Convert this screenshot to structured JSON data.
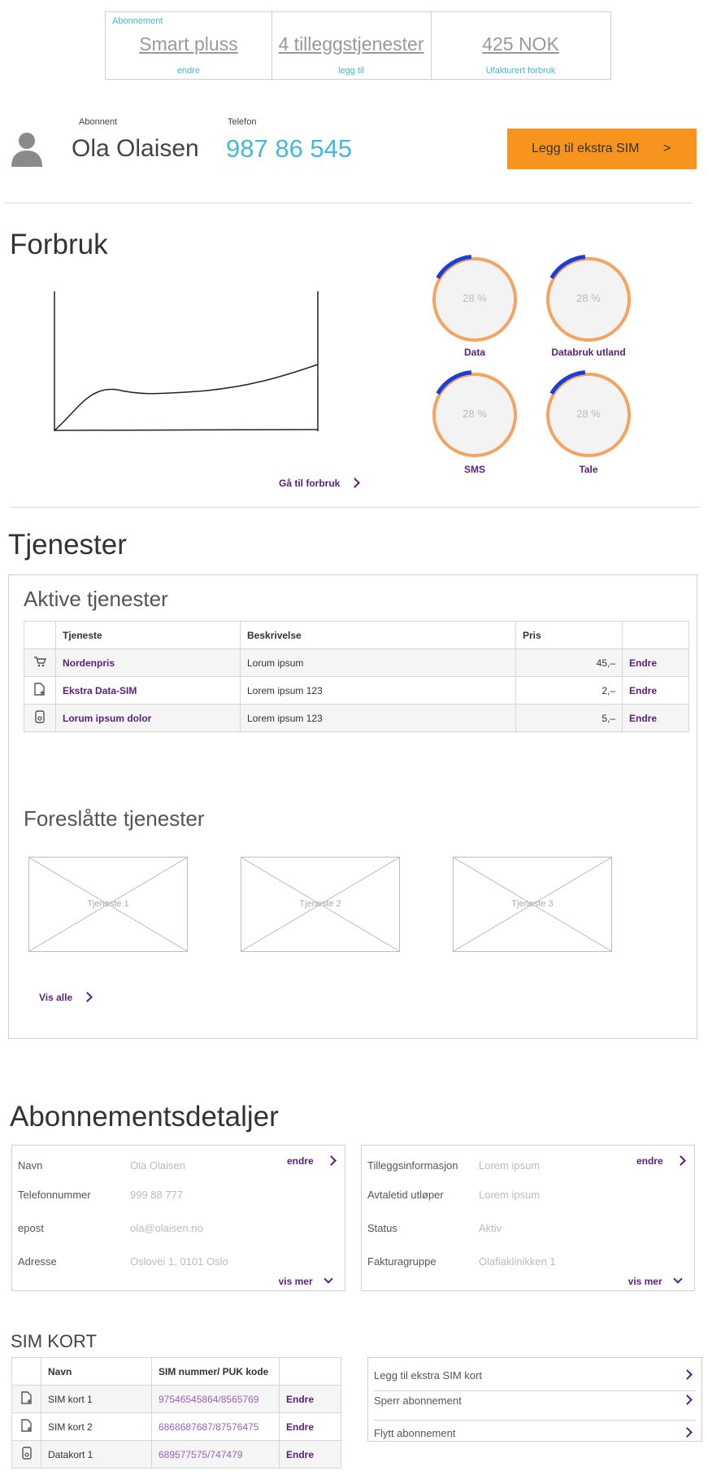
{
  "summary": {
    "tag": "Abonnement",
    "cells": [
      {
        "big": "Smart pluss",
        "small": "endre"
      },
      {
        "big": "4 tilleggstjenester",
        "small": "legg til"
      },
      {
        "big": "425 NOK",
        "small": "Ufakturert forbruk"
      }
    ]
  },
  "subscriber": {
    "name_label": "Abonnent",
    "name": "Ola Olaisen",
    "phone_label": "Telefon",
    "phone": "987 86 545",
    "cta": "Legg til ekstra SIM",
    "cta_arrow": ">"
  },
  "usage": {
    "title": "Forbruk",
    "link": "Gå til forbruk",
    "donuts": [
      {
        "label": "Data",
        "percent_text": "28 %",
        "value": 0.28
      },
      {
        "label": "Databruk utland",
        "percent_text": "28 %",
        "value": 0.28
      },
      {
        "label": "SMS",
        "percent_text": "28 %",
        "value": 0.28
      },
      {
        "label": "Tale",
        "percent_text": "28 %",
        "value": 0.28
      }
    ],
    "colors": {
      "ring": "#f4a460",
      "progress": "#1a3fd6",
      "fill": "#f3f3f3"
    }
  },
  "services": {
    "title": "Tjenester",
    "active_title": "Aktive tjenester",
    "columns": [
      "Tjeneste",
      "Beskrivelse",
      "Pris"
    ],
    "rows": [
      {
        "icon": "cart-icon",
        "name": "Nordenpris",
        "desc": "Lorum ipsum",
        "price": "45,–",
        "action": "Endre"
      },
      {
        "icon": "sim-add-icon",
        "name": "Ekstra Data-SIM",
        "desc": "Lorem ipsum 123",
        "price": "2,–",
        "action": "Endre"
      },
      {
        "icon": "device-icon",
        "name": "Lorum ipsum dolor",
        "desc": "Lorem ipsum 123",
        "price": "5,–",
        "action": "Endre"
      }
    ],
    "suggested_title": "Foreslåtte tjenester",
    "suggested": [
      "Tjeneste 1",
      "Tjeneste 2",
      "Tjeneste 3"
    ],
    "see_all": "Vis alle"
  },
  "details": {
    "title": "Abonnementsdetaljer",
    "left": {
      "edit": "endre",
      "more": "vis mer",
      "rows": [
        {
          "key": "Navn",
          "val": "Ola Olaisen"
        },
        {
          "key": "Telefonnummer",
          "val": "999 88 777"
        },
        {
          "key": "epost",
          "val": "ola@olaisen.no"
        },
        {
          "key": "Adresse",
          "val": "Oslovei 1, 0101 Oslo"
        }
      ]
    },
    "right": {
      "edit": "endre",
      "more": "vis mer",
      "rows": [
        {
          "key": "Tilleggsinformasjon",
          "val": "Lorem ipsum"
        },
        {
          "key": "Avtaletid utløper",
          "val": "Lorem ipsum"
        },
        {
          "key": "Status",
          "val": "Aktiv"
        },
        {
          "key": "Fakturagruppe",
          "val": "Olafiaklinikken 1"
        }
      ]
    }
  },
  "sim": {
    "title": "SIM KORT",
    "columns": [
      "Navn",
      "SIM nummer/ PUK kode"
    ],
    "rows": [
      {
        "icon": "sim-add-icon",
        "name": "SIM kort 1",
        "number": "97546545864/8565769",
        "action": "Endre"
      },
      {
        "icon": "sim-add-icon",
        "name": "SIM kort 2",
        "number": "6868687687/87576475",
        "action": "Endre"
      },
      {
        "icon": "device-icon",
        "name": "Datakort 1",
        "number": "689577575/747479",
        "action": "Endre"
      }
    ],
    "actions": [
      "Legg til ekstra SIM kort",
      "Sperr abonnement",
      "Flytt abonnement"
    ]
  }
}
